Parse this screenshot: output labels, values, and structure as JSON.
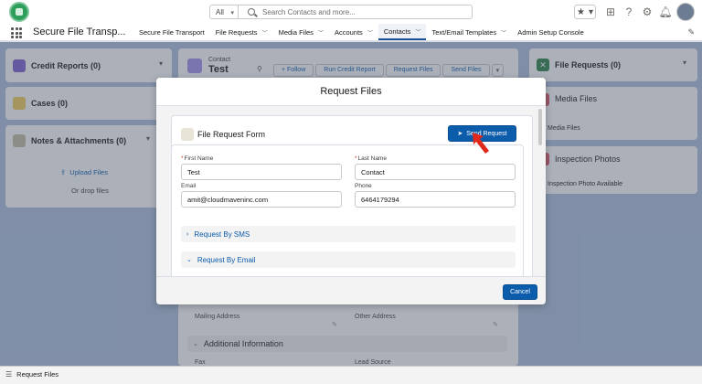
{
  "header": {
    "search_scope": "All",
    "search_placeholder": "Search Contacts and more..."
  },
  "nav": {
    "app_name": "Secure File Transp...",
    "items": [
      {
        "label": "Secure File Transport"
      },
      {
        "label": "File Requests"
      },
      {
        "label": "Media Files"
      },
      {
        "label": "Accounts"
      },
      {
        "label": "Contacts"
      },
      {
        "label": "Text/Email Templates"
      },
      {
        "label": "Admin Setup Console"
      }
    ]
  },
  "left_panel": {
    "credit_reports": "Credit Reports (0)",
    "cases": "Cases (0)",
    "notes": "Notes & Attachments (0)",
    "upload_files": "Upload Files",
    "drop_files": "Or drop files"
  },
  "record": {
    "object": "Contact",
    "name": "Test",
    "actions": [
      {
        "label": "+ Follow"
      },
      {
        "label": "Run Credit Report"
      },
      {
        "label": "Request Files"
      },
      {
        "label": "Send Files"
      }
    ],
    "mailing_address_label": "Mailing Address",
    "other_address_label": "Other Address",
    "additional_info": "Additional Information",
    "fax_label": "Fax",
    "lead_source_label": "Lead Source"
  },
  "right_panel": {
    "file_requests": "File Requests (0)",
    "media_files": "Media Files",
    "media_files_sub": "Media Files",
    "inspection_photos": "Inspection Photos",
    "inspection_sub": "Inspection Photo Available"
  },
  "modal": {
    "title": "Request Files",
    "form_title": "File Request Form",
    "send_button": "Send Request",
    "fields": {
      "first_name_label": "First Name",
      "first_name_value": "Test",
      "last_name_label": "Last Name",
      "last_name_value": "Contact",
      "email_label": "Email",
      "email_value": "amit@cloudmaveninc.com",
      "phone_label": "Phone",
      "phone_value": "6464179294"
    },
    "sections": [
      {
        "label": "Request By SMS"
      },
      {
        "label": "Request By Email"
      }
    ],
    "cancel_button": "Cancel"
  },
  "utility_bar": {
    "label": "Request Files"
  },
  "colors": {
    "brand_blue": "#0b5cab",
    "overlay_bg": "#b0c4df",
    "arrow_red": "#e0281c"
  }
}
